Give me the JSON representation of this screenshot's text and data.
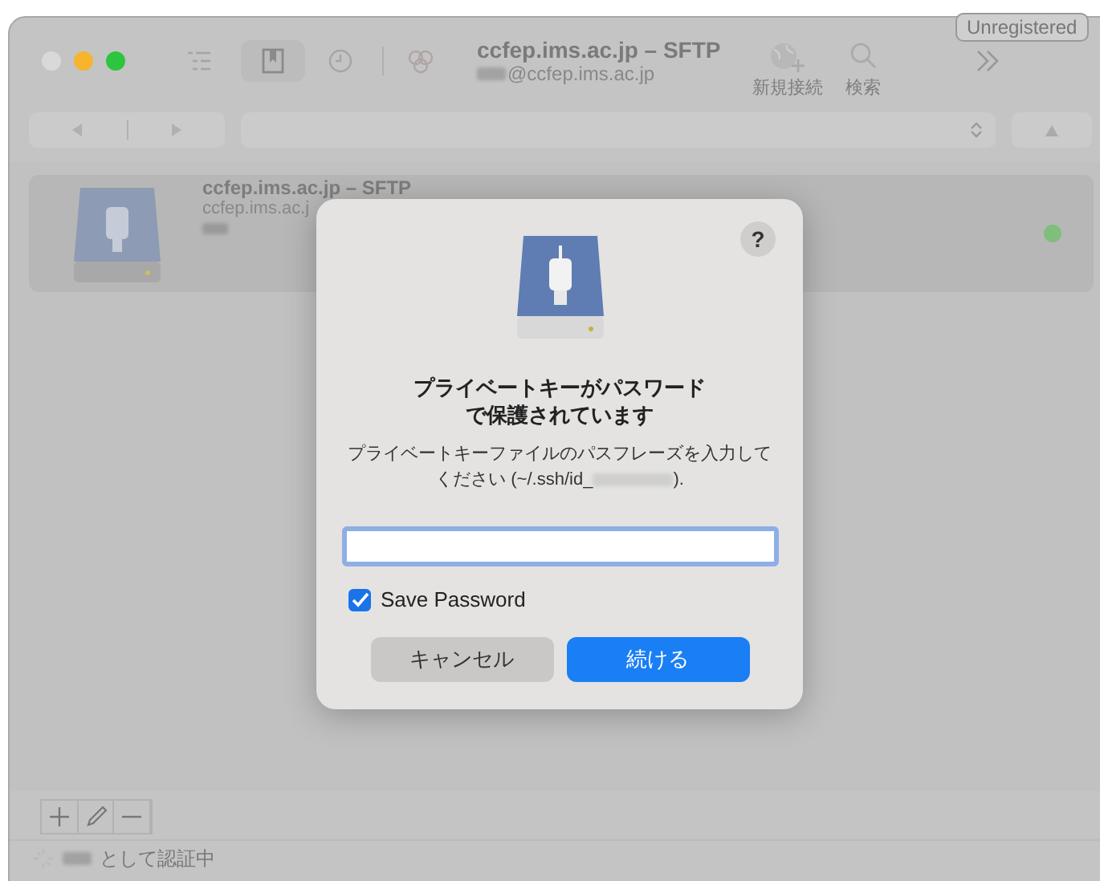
{
  "window": {
    "title": "ccfep.ims.ac.jp – SFTP",
    "subtitle": "@ccfep.ims.ac.jp",
    "badge": "Unregistered"
  },
  "toolbar": [
    {
      "label": "新規接続",
      "kind": "globe"
    },
    {
      "label": "検索",
      "kind": "search"
    }
  ],
  "bookmarks": [
    {
      "title": "ccfep.ims.ac.jp – SFTP",
      "host": "ccfep.ims.ac.j",
      "connected": true
    }
  ],
  "dialog": {
    "help": "?",
    "title": "プライベートキーがパスワードで保護されています",
    "description": "プライベートキーファイルのパスフレーズを入力してください (~/.ssh/id_",
    "description_end": ").",
    "save_password": {
      "label": "Save Password",
      "checked": true
    },
    "buttons": [
      {
        "label": "キャンセル",
        "kind": "cancel"
      },
      {
        "label": "続ける",
        "kind": "default"
      }
    ]
  },
  "status": "として認証中"
}
